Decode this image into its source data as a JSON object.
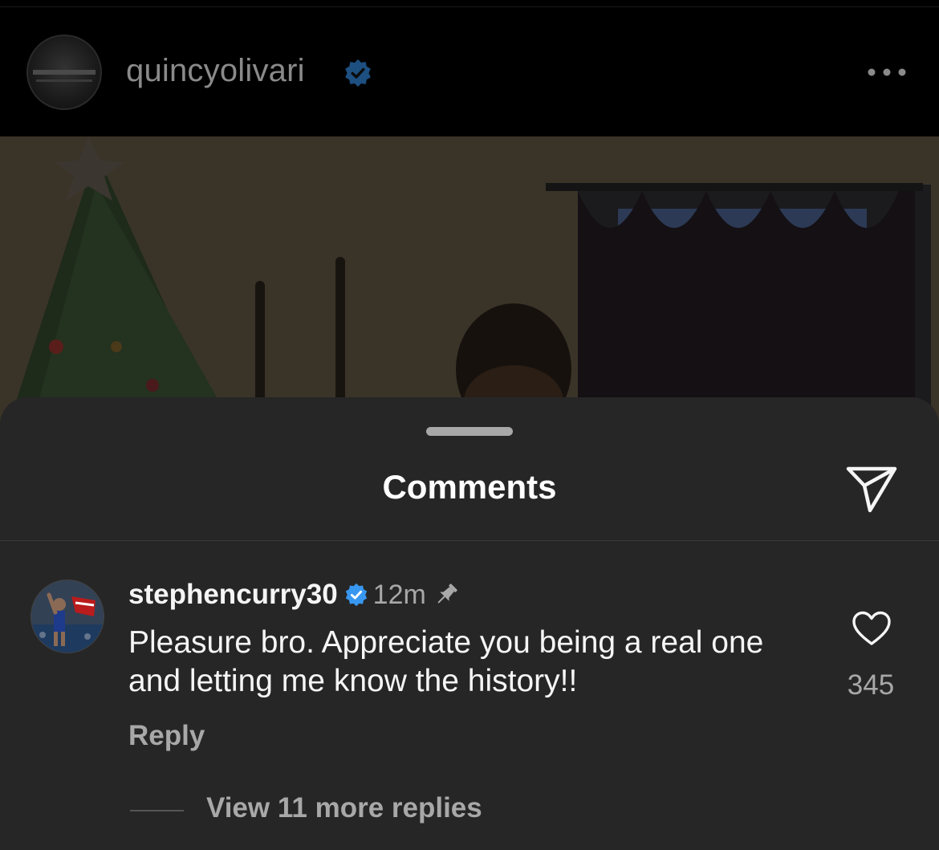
{
  "post": {
    "username": "quincyolivari",
    "verified": true,
    "more_icon": "more-horizontal-icon"
  },
  "comments_sheet": {
    "title": "Comments",
    "share_icon": "send-icon"
  },
  "comments": [
    {
      "username": "stephencurry30",
      "verified": true,
      "time": "12m",
      "pinned": true,
      "text": "Pleasure bro. Appreciate you being a real one and letting me know the history!!",
      "likes": "345",
      "reply_label": "Reply",
      "view_replies_label": "View 11 more replies"
    }
  ],
  "colors": {
    "sheet_bg": "#262626",
    "verified_blue": "#3897f0",
    "secondary_text": "#a8a8a8"
  }
}
